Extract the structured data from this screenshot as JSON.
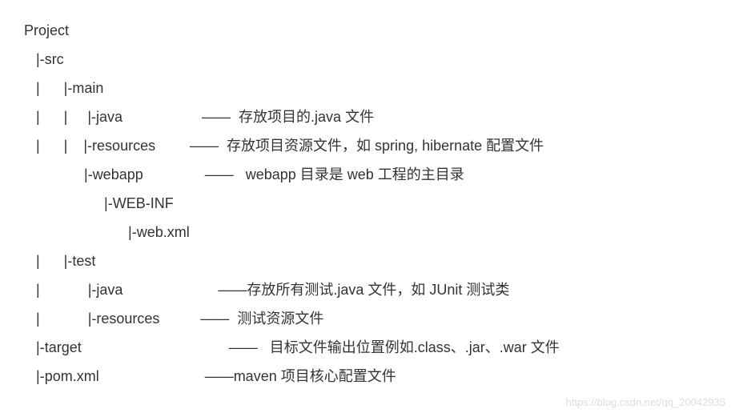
{
  "tree": {
    "root": {
      "prefix": "",
      "name": "Project",
      "desc": ""
    },
    "src": {
      "prefix": "   |-",
      "name": "src",
      "desc": ""
    },
    "main": {
      "prefix": "   |      |-",
      "name": "main",
      "desc": ""
    },
    "main_java": {
      "prefix": "   |      |     |-",
      "name": "java",
      "desc": "——  存放项目的.java 文件"
    },
    "main_resources": {
      "prefix": "   |      |    |-",
      "name": "resources",
      "desc": "——  存放项目资源文件，如 spring, hibernate 配置文件"
    },
    "webapp": {
      "prefix": "               |-",
      "name": "webapp",
      "desc": "——   webapp 目录是 web 工程的主目录"
    },
    "webinf": {
      "prefix": "                    |-",
      "name": "WEB-INF",
      "desc": ""
    },
    "webxml": {
      "prefix": "                          |-",
      "name": "web.xml",
      "desc": ""
    },
    "test": {
      "prefix": "   |      |-",
      "name": "test",
      "desc": ""
    },
    "test_java": {
      "prefix": "   |            |-",
      "name": "java",
      "desc": "——存放所有测试.java 文件，如 JUnit 测试类"
    },
    "test_resources": {
      "prefix": "   |            |-",
      "name": "resources",
      "desc": "——  测试资源文件"
    },
    "target": {
      "prefix": "   |-",
      "name": "target",
      "desc": "——   目标文件输出位置例如.class、.jar、.war 文件"
    },
    "pom": {
      "prefix": "   |-",
      "name": "pom.xml",
      "desc": "——maven 项目核心配置文件"
    }
  },
  "watermark": "https://blog.csdn.net/qq_20042935"
}
